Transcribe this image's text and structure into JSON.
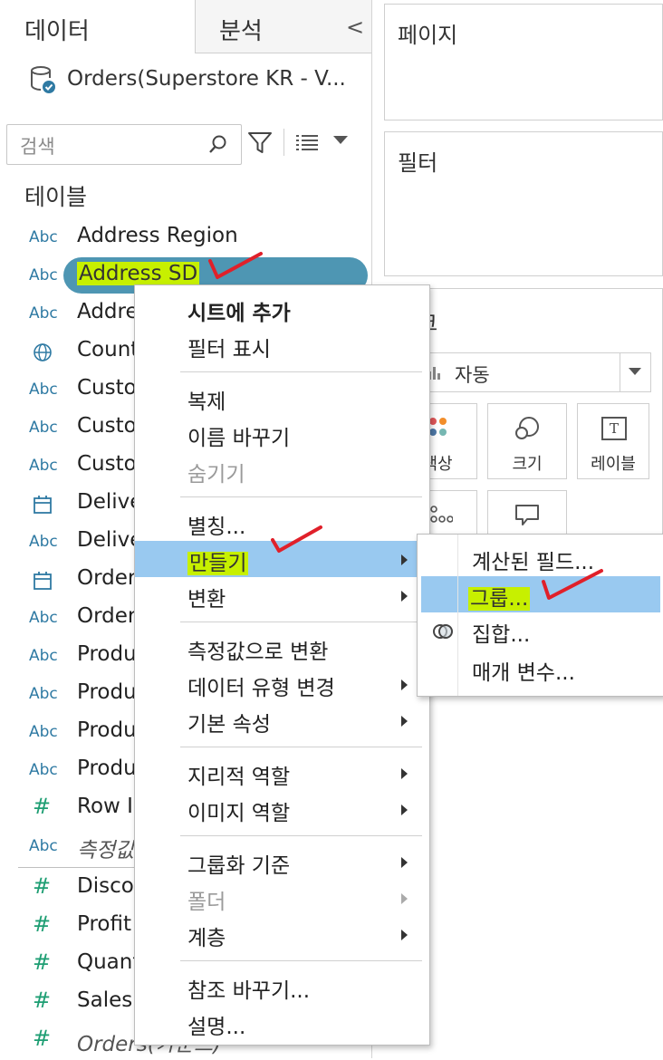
{
  "tabs": {
    "data_label": "데이터",
    "analysis_label": "분석",
    "collapse_glyph": "<"
  },
  "datasource": {
    "name": "Orders(Superstore KR - V..."
  },
  "search": {
    "placeholder": "검색"
  },
  "tables_heading": "테이블",
  "fields": [
    {
      "type": "Abc",
      "name": "Address Region"
    },
    {
      "type": "Abc",
      "name": "Address SD",
      "selected": true
    },
    {
      "type": "Abc",
      "name": "Addre"
    },
    {
      "type": "globe-icon",
      "name": "Count"
    },
    {
      "type": "Abc",
      "name": "Custo"
    },
    {
      "type": "Abc",
      "name": "Custo"
    },
    {
      "type": "Abc",
      "name": "Custo"
    },
    {
      "type": "calendar-icon",
      "name": "Delive"
    },
    {
      "type": "Abc",
      "name": "Delive"
    },
    {
      "type": "calendar-icon",
      "name": "Order"
    },
    {
      "type": "Abc",
      "name": "Order"
    },
    {
      "type": "Abc",
      "name": "Produ"
    },
    {
      "type": "Abc",
      "name": "Produ"
    },
    {
      "type": "Abc",
      "name": "Produ"
    },
    {
      "type": "Abc",
      "name": "Produ"
    },
    {
      "type": "#",
      "name": "Row II"
    },
    {
      "type": "Abc",
      "name": "측정값",
      "italic": true
    }
  ],
  "measures": [
    {
      "type": "#",
      "name": "Discou"
    },
    {
      "type": "#",
      "name": "Profit"
    },
    {
      "type": "#",
      "name": "Quant"
    },
    {
      "type": "#",
      "name": "Sales"
    },
    {
      "type": "#",
      "name": "Orders(카운트)",
      "italic": true
    }
  ],
  "shelves": {
    "pages_title": "페이지",
    "filters_title": "필터",
    "marks_title": "마크",
    "mark_type": "자동",
    "color_label": "색상",
    "size_label": "크기",
    "label_label": "레이블",
    "text_glyph": "T"
  },
  "context_menu": [
    {
      "label": "시트에 추가",
      "bold": true
    },
    {
      "label": "필터 표시"
    },
    {
      "sep": true
    },
    {
      "label": "복제"
    },
    {
      "label": "이름 바꾸기"
    },
    {
      "label": "숨기기",
      "disabled": true
    },
    {
      "sep": true
    },
    {
      "label": "별칭..."
    },
    {
      "label": "만들기",
      "submenu": true,
      "active": true
    },
    {
      "label": "변환",
      "submenu": true
    },
    {
      "sep": true
    },
    {
      "label": "측정값으로 변환"
    },
    {
      "label": "데이터 유형 변경",
      "submenu": true
    },
    {
      "label": "기본 속성",
      "submenu": true
    },
    {
      "sep": true
    },
    {
      "label": "지리적 역할",
      "submenu": true
    },
    {
      "label": "이미지 역할",
      "submenu": true
    },
    {
      "sep": true
    },
    {
      "label": "그룹화 기준",
      "submenu": true
    },
    {
      "label": "폴더",
      "submenu": true,
      "disabled": true
    },
    {
      "label": "계층",
      "submenu": true
    },
    {
      "sep": true
    },
    {
      "label": "참조 바꾸기..."
    },
    {
      "label": "설명..."
    }
  ],
  "submenu": [
    {
      "label": "계산된 필드..."
    },
    {
      "label": "그룹...",
      "active": true
    },
    {
      "label": "집합...",
      "icon": "set-icon"
    },
    {
      "label": "매개 변수..."
    }
  ],
  "colors": {
    "selection_pill": "#4e96b3",
    "highlighter": "#c7f000",
    "menu_active": "#99c9f0",
    "annotation_check": "#e0202a",
    "dimension_icon": "#2f7aa3",
    "measure_icon": "#1e9e73"
  }
}
